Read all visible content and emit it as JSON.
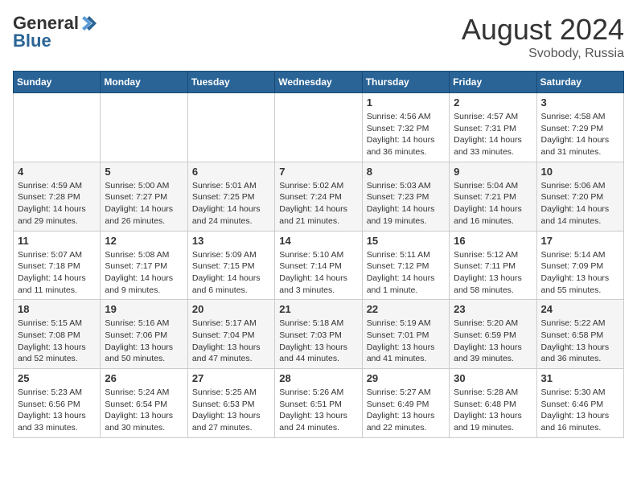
{
  "logo": {
    "general": "General",
    "blue": "Blue"
  },
  "header": {
    "title": "August 2024",
    "subtitle": "Svobody, Russia"
  },
  "weekdays": [
    "Sunday",
    "Monday",
    "Tuesday",
    "Wednesday",
    "Thursday",
    "Friday",
    "Saturday"
  ],
  "weeks": [
    [
      {
        "day": "",
        "info": ""
      },
      {
        "day": "",
        "info": ""
      },
      {
        "day": "",
        "info": ""
      },
      {
        "day": "",
        "info": ""
      },
      {
        "day": "1",
        "info": "Sunrise: 4:56 AM\nSunset: 7:32 PM\nDaylight: 14 hours\nand 36 minutes."
      },
      {
        "day": "2",
        "info": "Sunrise: 4:57 AM\nSunset: 7:31 PM\nDaylight: 14 hours\nand 33 minutes."
      },
      {
        "day": "3",
        "info": "Sunrise: 4:58 AM\nSunset: 7:29 PM\nDaylight: 14 hours\nand 31 minutes."
      }
    ],
    [
      {
        "day": "4",
        "info": "Sunrise: 4:59 AM\nSunset: 7:28 PM\nDaylight: 14 hours\nand 29 minutes."
      },
      {
        "day": "5",
        "info": "Sunrise: 5:00 AM\nSunset: 7:27 PM\nDaylight: 14 hours\nand 26 minutes."
      },
      {
        "day": "6",
        "info": "Sunrise: 5:01 AM\nSunset: 7:25 PM\nDaylight: 14 hours\nand 24 minutes."
      },
      {
        "day": "7",
        "info": "Sunrise: 5:02 AM\nSunset: 7:24 PM\nDaylight: 14 hours\nand 21 minutes."
      },
      {
        "day": "8",
        "info": "Sunrise: 5:03 AM\nSunset: 7:23 PM\nDaylight: 14 hours\nand 19 minutes."
      },
      {
        "day": "9",
        "info": "Sunrise: 5:04 AM\nSunset: 7:21 PM\nDaylight: 14 hours\nand 16 minutes."
      },
      {
        "day": "10",
        "info": "Sunrise: 5:06 AM\nSunset: 7:20 PM\nDaylight: 14 hours\nand 14 minutes."
      }
    ],
    [
      {
        "day": "11",
        "info": "Sunrise: 5:07 AM\nSunset: 7:18 PM\nDaylight: 14 hours\nand 11 minutes."
      },
      {
        "day": "12",
        "info": "Sunrise: 5:08 AM\nSunset: 7:17 PM\nDaylight: 14 hours\nand 9 minutes."
      },
      {
        "day": "13",
        "info": "Sunrise: 5:09 AM\nSunset: 7:15 PM\nDaylight: 14 hours\nand 6 minutes."
      },
      {
        "day": "14",
        "info": "Sunrise: 5:10 AM\nSunset: 7:14 PM\nDaylight: 14 hours\nand 3 minutes."
      },
      {
        "day": "15",
        "info": "Sunrise: 5:11 AM\nSunset: 7:12 PM\nDaylight: 14 hours\nand 1 minute."
      },
      {
        "day": "16",
        "info": "Sunrise: 5:12 AM\nSunset: 7:11 PM\nDaylight: 13 hours\nand 58 minutes."
      },
      {
        "day": "17",
        "info": "Sunrise: 5:14 AM\nSunset: 7:09 PM\nDaylight: 13 hours\nand 55 minutes."
      }
    ],
    [
      {
        "day": "18",
        "info": "Sunrise: 5:15 AM\nSunset: 7:08 PM\nDaylight: 13 hours\nand 52 minutes."
      },
      {
        "day": "19",
        "info": "Sunrise: 5:16 AM\nSunset: 7:06 PM\nDaylight: 13 hours\nand 50 minutes."
      },
      {
        "day": "20",
        "info": "Sunrise: 5:17 AM\nSunset: 7:04 PM\nDaylight: 13 hours\nand 47 minutes."
      },
      {
        "day": "21",
        "info": "Sunrise: 5:18 AM\nSunset: 7:03 PM\nDaylight: 13 hours\nand 44 minutes."
      },
      {
        "day": "22",
        "info": "Sunrise: 5:19 AM\nSunset: 7:01 PM\nDaylight: 13 hours\nand 41 minutes."
      },
      {
        "day": "23",
        "info": "Sunrise: 5:20 AM\nSunset: 6:59 PM\nDaylight: 13 hours\nand 39 minutes."
      },
      {
        "day": "24",
        "info": "Sunrise: 5:22 AM\nSunset: 6:58 PM\nDaylight: 13 hours\nand 36 minutes."
      }
    ],
    [
      {
        "day": "25",
        "info": "Sunrise: 5:23 AM\nSunset: 6:56 PM\nDaylight: 13 hours\nand 33 minutes."
      },
      {
        "day": "26",
        "info": "Sunrise: 5:24 AM\nSunset: 6:54 PM\nDaylight: 13 hours\nand 30 minutes."
      },
      {
        "day": "27",
        "info": "Sunrise: 5:25 AM\nSunset: 6:53 PM\nDaylight: 13 hours\nand 27 minutes."
      },
      {
        "day": "28",
        "info": "Sunrise: 5:26 AM\nSunset: 6:51 PM\nDaylight: 13 hours\nand 24 minutes."
      },
      {
        "day": "29",
        "info": "Sunrise: 5:27 AM\nSunset: 6:49 PM\nDaylight: 13 hours\nand 22 minutes."
      },
      {
        "day": "30",
        "info": "Sunrise: 5:28 AM\nSunset: 6:48 PM\nDaylight: 13 hours\nand 19 minutes."
      },
      {
        "day": "31",
        "info": "Sunrise: 5:30 AM\nSunset: 6:46 PM\nDaylight: 13 hours\nand 16 minutes."
      }
    ]
  ]
}
